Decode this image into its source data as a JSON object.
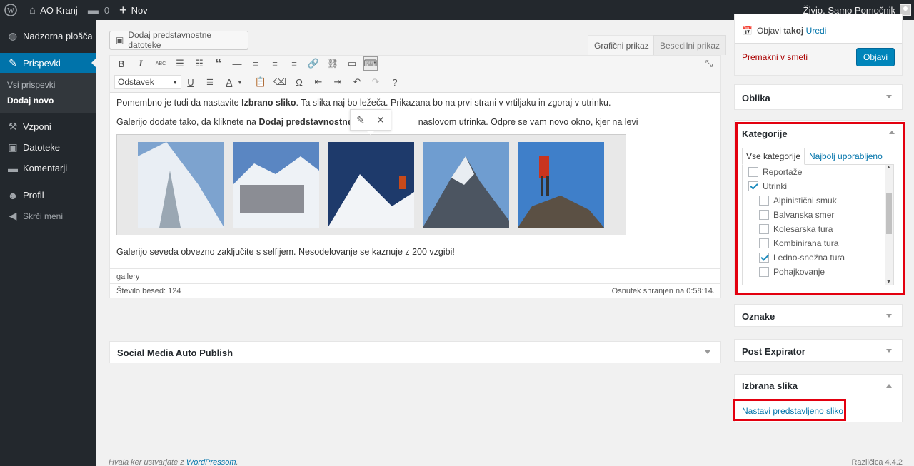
{
  "admin_bar": {
    "site_name": "AO Kranj",
    "comments_count": "0",
    "new_label": "Nov",
    "greeting": "Živjo, Samo Pomočnik"
  },
  "menu": {
    "dashboard": "Nadzorna plošča",
    "posts": "Prispevki",
    "posts_sub": {
      "all": "Vsi prispevki",
      "add": "Dodaj novo"
    },
    "routes": "Vzponi",
    "media": "Datoteke",
    "comments": "Komentarji",
    "profile": "Profil",
    "collapse": "Skrči meni"
  },
  "editor": {
    "add_media": "Dodaj predstavnostne datoteke",
    "tab_visual": "Grafični prikaz",
    "tab_text": "Besedilni prikaz",
    "format_select": "Odstavek",
    "p1_a": "Pomembno je tudi da nastavite ",
    "p1_b": "Izbrano sliko",
    "p1_c": ". Ta slika naj bo ležeča. Prikazana bo na prvi strani v vrtiljaku in zgoraj v utrinku.",
    "p2_a": "Galerijo dodate tako, da kliknete na ",
    "p2_b": "Dodaj predstavnostne datot",
    "p2_c": "naslovom utrinka. Odpre se vam novo okno, kjer na levi",
    "p3": "Galerijo seveda obvezno zaključite s selfijem. Nesodelovanje se kaznuje z 200 vzgibi!",
    "path": "gallery",
    "word_count": "Število besed: 124",
    "draft_saved": "Osnutek shranjen na 0:58:14."
  },
  "publish": {
    "schedule_a": "Objavi",
    "schedule_b": "takoj",
    "edit": "Uredi",
    "trash": "Premakni v smeti",
    "publish_btn": "Objavi"
  },
  "boxes": {
    "format": "Oblika",
    "categories": "Kategorije",
    "tags": "Oznake",
    "expirator": "Post Expirator",
    "featured": "Izbrana slika",
    "featured_link": "Nastavi predstavljeno sliko",
    "social": "Social Media Auto Publish"
  },
  "categories": {
    "tab_all": "Vse kategorije",
    "tab_popular": "Najbolj uporabljeno",
    "items": [
      {
        "label": "Reportaže",
        "checked": false,
        "level": 0
      },
      {
        "label": "Utrinki",
        "checked": true,
        "level": 0
      },
      {
        "label": "Alpinistični smuk",
        "checked": false,
        "level": 1
      },
      {
        "label": "Balvanska smer",
        "checked": false,
        "level": 1
      },
      {
        "label": "Kolesarska tura",
        "checked": false,
        "level": 1
      },
      {
        "label": "Kombinirana tura",
        "checked": false,
        "level": 1
      },
      {
        "label": "Ledno-snežna tura",
        "checked": true,
        "level": 1
      },
      {
        "label": "Pohajkovanje",
        "checked": false,
        "level": 1
      }
    ]
  },
  "footer": {
    "thanks_a": "Hvala ker ustvarjate z ",
    "thanks_link": "WordPressom",
    "thanks_b": ".",
    "version": "Različica 4.4.2"
  },
  "colors": {
    "accent": "#0073aa",
    "highlight": "#e3000f",
    "adminbar": "#23282d"
  }
}
